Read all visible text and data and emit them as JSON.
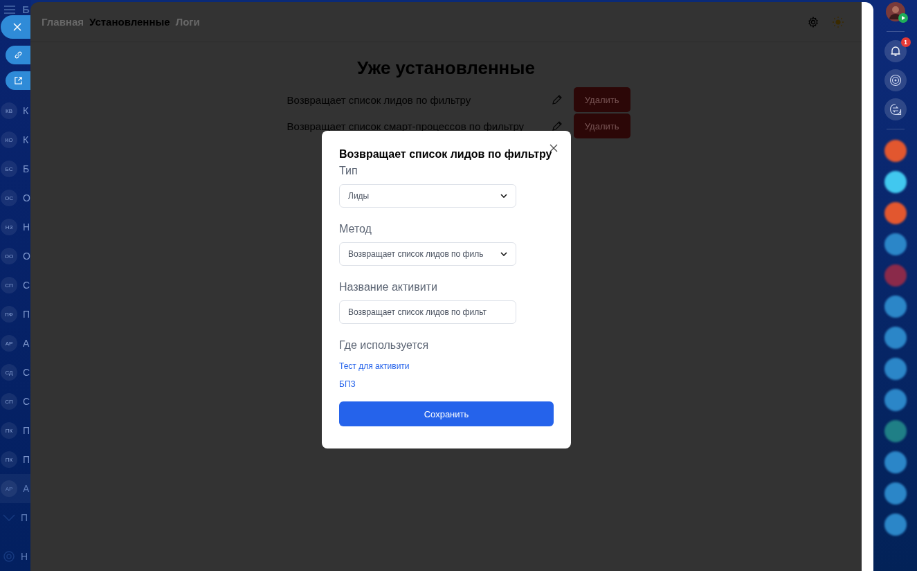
{
  "left_sidebar": {
    "menu_label": "Б",
    "items": [
      {
        "initials": "КВ",
        "label": "К",
        "selected": false
      },
      {
        "initials": "КО",
        "label": "К",
        "selected": false
      },
      {
        "initials": "БС",
        "label": "Б",
        "selected": false
      },
      {
        "initials": "ОС",
        "label": "О",
        "selected": false
      },
      {
        "initials": "НЗ",
        "label": "Н",
        "selected": false
      },
      {
        "initials": "ОО",
        "label": "О",
        "selected": false
      },
      {
        "initials": "СП",
        "label": "С",
        "selected": false
      },
      {
        "initials": "ПФ",
        "label": "П",
        "selected": false
      },
      {
        "initials": "АР",
        "label": "А",
        "selected": false
      },
      {
        "initials": "СД",
        "label": "С",
        "selected": false
      },
      {
        "initials": "СП",
        "label": "С",
        "selected": false
      },
      {
        "initials": "ПК",
        "label": "П",
        "selected": false
      },
      {
        "initials": "ПК",
        "label": "П",
        "selected": false
      },
      {
        "initials": "АР",
        "label": "А",
        "selected": true
      }
    ],
    "more_label": "П",
    "settings_label": "Н"
  },
  "tabs": [
    {
      "label": "Главная",
      "selected": false
    },
    {
      "label": "Установленные",
      "selected": true
    },
    {
      "label": "Логи",
      "selected": false
    }
  ],
  "page_title": "Уже установленные",
  "installed": [
    {
      "name": "Возвращает список лидов по фильтру",
      "action": "Удалить"
    },
    {
      "name": "Возвращает список смарт-процессов по фильтру",
      "action": "Удалить"
    }
  ],
  "dialog": {
    "title": "Возвращает список лидов по фильтру",
    "fields": [
      {
        "kind": "select",
        "label": "Тип",
        "value": "Лиды"
      },
      {
        "kind": "select",
        "label": "Метод",
        "value": "Возвращает список лидов по филь"
      },
      {
        "kind": "input",
        "label": "Название активити",
        "value": "Возвращает список лидов по фильт"
      }
    ],
    "usage_label": "Где используется",
    "usage_links": [
      "Тест для активити",
      "БПЗ"
    ],
    "save": "Сохранить"
  },
  "right_bar": {
    "notifications_badge": "1",
    "apps": [
      {
        "color": "#e2572f"
      },
      {
        "color": "#41c8ef"
      },
      {
        "color": "#e2572f"
      },
      {
        "color": "#2b86c8"
      },
      {
        "color": "#8a2a4a"
      },
      {
        "color": "#2b86c8"
      },
      {
        "color": "#2b86c8"
      },
      {
        "color": "#2b86c8"
      },
      {
        "color": "#2b86c8"
      },
      {
        "color": "#1f7f86"
      },
      {
        "color": "#2b86c8"
      },
      {
        "color": "#2b86c8"
      },
      {
        "color": "#2b86c8"
      }
    ]
  }
}
